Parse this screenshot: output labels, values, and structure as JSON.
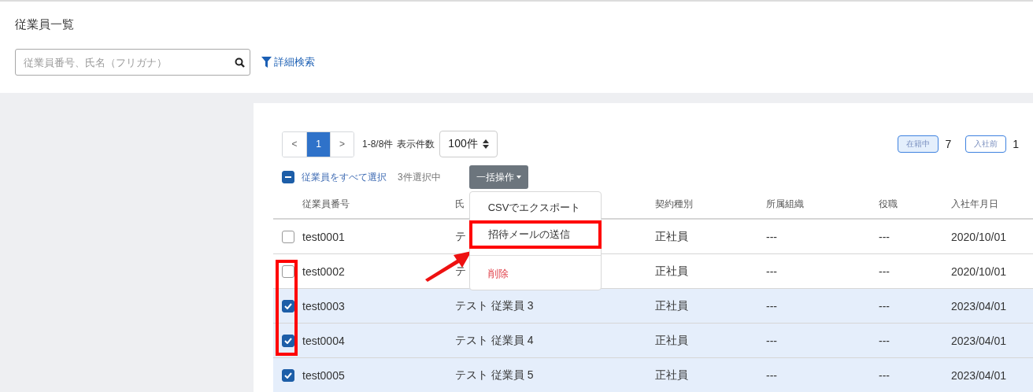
{
  "page_title": "従業員一覧",
  "search": {
    "placeholder": "従業員番号、氏名（フリガナ）",
    "advanced_link": "詳細検索"
  },
  "pagination": {
    "prev": "<",
    "pages": [
      {
        "label": "1",
        "selected": true
      }
    ],
    "next": ">",
    "range": "1-8/8件",
    "per_page_label": "表示件数",
    "per_page": "100件"
  },
  "status_filters": [
    {
      "label": "在籍中",
      "count": "7",
      "selected": true
    },
    {
      "label": "入社前",
      "count": "1",
      "selected": false
    }
  ],
  "selection": {
    "select_all": "従業員をすべて選択",
    "indeterminate": true,
    "selected_count": "3件選択中",
    "bulk_button": "一括操作"
  },
  "bulk_menu": {
    "expanded": true,
    "items": [
      {
        "label": "CSVでエクスポート",
        "kind": "normal",
        "highlighted": false
      },
      {
        "label": "招待メールの送信",
        "kind": "normal",
        "highlighted": true
      },
      {
        "kind": "divider"
      },
      {
        "label": "削除",
        "kind": "danger",
        "highlighted": false
      }
    ]
  },
  "table": {
    "columns": [
      "従業員番号",
      "氏",
      "契約種別",
      "所属組織",
      "役職",
      "入社年月日"
    ],
    "rows": [
      {
        "checked": false,
        "cells": [
          "test0001",
          "テ",
          "正社員",
          "---",
          "---",
          "2020/10/01"
        ]
      },
      {
        "checked": false,
        "cells": [
          "test0002",
          "テ",
          "正社員",
          "---",
          "---",
          "2020/10/01"
        ]
      },
      {
        "checked": true,
        "cells": [
          "test0003",
          "テスト 従業員 3",
          "正社員",
          "---",
          "---",
          "2023/04/01"
        ]
      },
      {
        "checked": true,
        "cells": [
          "test0004",
          "テスト 従業員 4",
          "正社員",
          "---",
          "---",
          "2023/04/01"
        ]
      },
      {
        "checked": true,
        "cells": [
          "test0005",
          "テスト 従業員 5",
          "正社員",
          "---",
          "---",
          "2023/04/01"
        ]
      }
    ]
  }
}
